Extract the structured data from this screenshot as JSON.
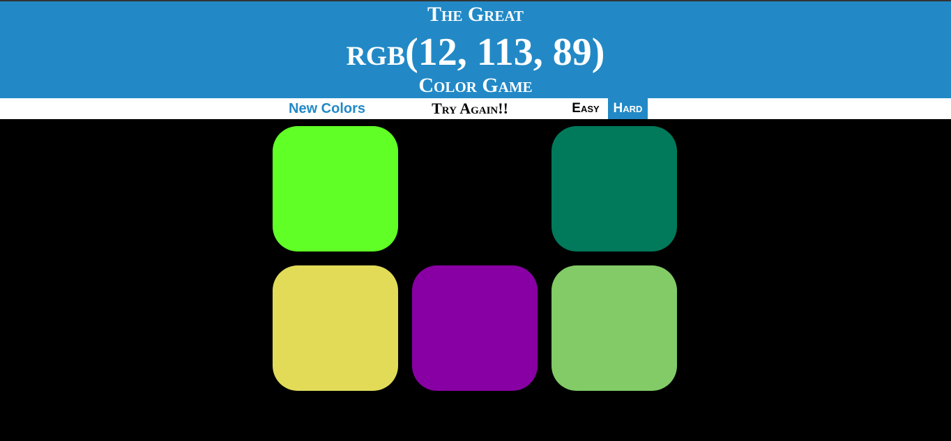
{
  "header": {
    "title_top": "The Great",
    "rgb_display": "rgb(12, 113, 89)",
    "title_bottom": "Color Game"
  },
  "controls": {
    "new_colors_label": "New Colors",
    "message": "Try Again!!",
    "easy_label": "Easy",
    "hard_label": "Hard",
    "selected_mode": "Hard"
  },
  "colors": {
    "header_bg": "#2289c6",
    "page_bg": "#000000",
    "selected_mode_bg": "#2289c6"
  },
  "squares": [
    {
      "color": "#60ff26",
      "visible": true
    },
    {
      "color": "#000000",
      "visible": false
    },
    {
      "color": "#007a5b",
      "visible": true
    },
    {
      "color": "#e2db58",
      "visible": true
    },
    {
      "color": "#8800a3",
      "visible": true
    },
    {
      "color": "#82cb67",
      "visible": true
    }
  ]
}
